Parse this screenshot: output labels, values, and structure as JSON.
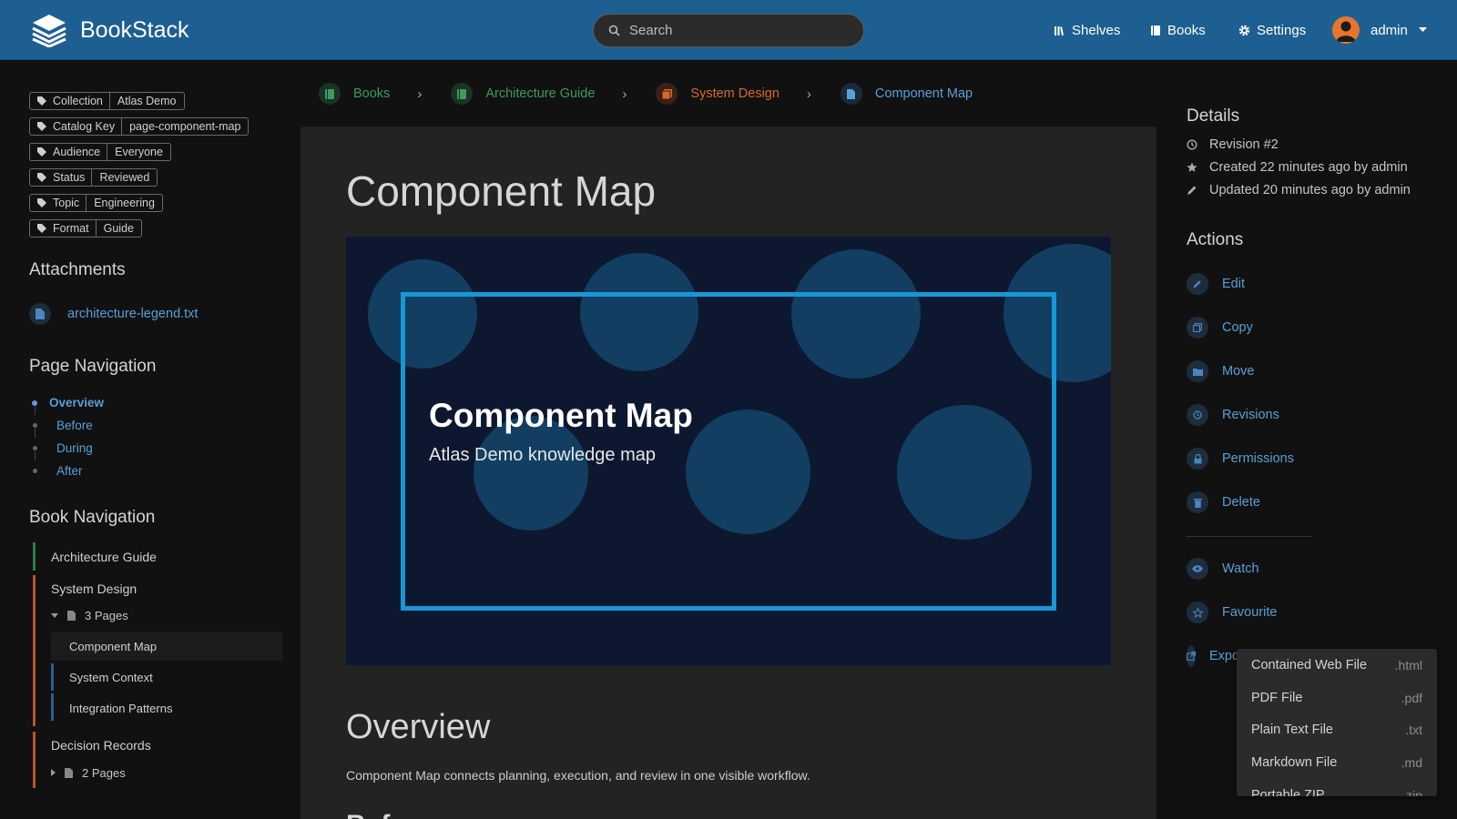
{
  "header": {
    "app_name": "BookStack",
    "search_placeholder": "Search",
    "nav": [
      "Shelves",
      "Books",
      "Settings"
    ],
    "user": "admin",
    "colors": {
      "bar": "#1d5f90",
      "avatar": "#e8752e"
    }
  },
  "tags": [
    {
      "key": "Collection",
      "value": "Atlas Demo"
    },
    {
      "key": "Catalog Key",
      "value": "page-component-map"
    },
    {
      "key": "Audience",
      "value": "Everyone"
    },
    {
      "key": "Status",
      "value": "Reviewed"
    },
    {
      "key": "Topic",
      "value": "Engineering"
    },
    {
      "key": "Format",
      "value": "Guide"
    }
  ],
  "attachments": {
    "title": "Attachments",
    "items": [
      "architecture-legend.txt"
    ]
  },
  "page_navigation": {
    "title": "Page Navigation",
    "items": [
      "Overview",
      "Before",
      "During",
      "After"
    ]
  },
  "book_navigation": {
    "title": "Book Navigation",
    "chapters": [
      {
        "name": "Architecture Guide"
      },
      {
        "name": "System Design",
        "pages_label": "3 Pages",
        "pages": [
          "Component Map",
          "System Context",
          "Integration Patterns"
        ]
      },
      {
        "name": "Decision Records",
        "pages_label": "2 Pages"
      }
    ]
  },
  "breadcrumbs": [
    {
      "label": "Books",
      "color": "#3f9a5c"
    },
    {
      "label": "Architecture Guide",
      "color": "#3f9a5c"
    },
    {
      "label": "System Design",
      "color": "#d8672f"
    },
    {
      "label": "Component Map",
      "color": "#5a9fd6"
    }
  ],
  "page": {
    "title": "Component Map",
    "hero_title": "Component Map",
    "hero_subtitle": "Atlas Demo knowledge map",
    "overview_heading": "Overview",
    "overview_text": "Component Map connects planning, execution, and review in one visible workflow.",
    "next_heading": "Before"
  },
  "details": {
    "title": "Details",
    "revision": "Revision #2",
    "created": "Created 22 minutes ago by admin",
    "updated": "Updated 20 minutes ago by admin"
  },
  "actions": {
    "title": "Actions",
    "items": [
      "Edit",
      "Copy",
      "Move",
      "Revisions",
      "Permissions",
      "Delete",
      "Watch",
      "Favourite",
      "Export"
    ]
  },
  "export_menu": [
    {
      "label": "Contained Web File",
      "ext": ".html"
    },
    {
      "label": "PDF File",
      "ext": ".pdf"
    },
    {
      "label": "Plain Text File",
      "ext": ".txt"
    },
    {
      "label": "Markdown File",
      "ext": ".md"
    },
    {
      "label": "Portable ZIP",
      "ext": ".zip"
    }
  ]
}
